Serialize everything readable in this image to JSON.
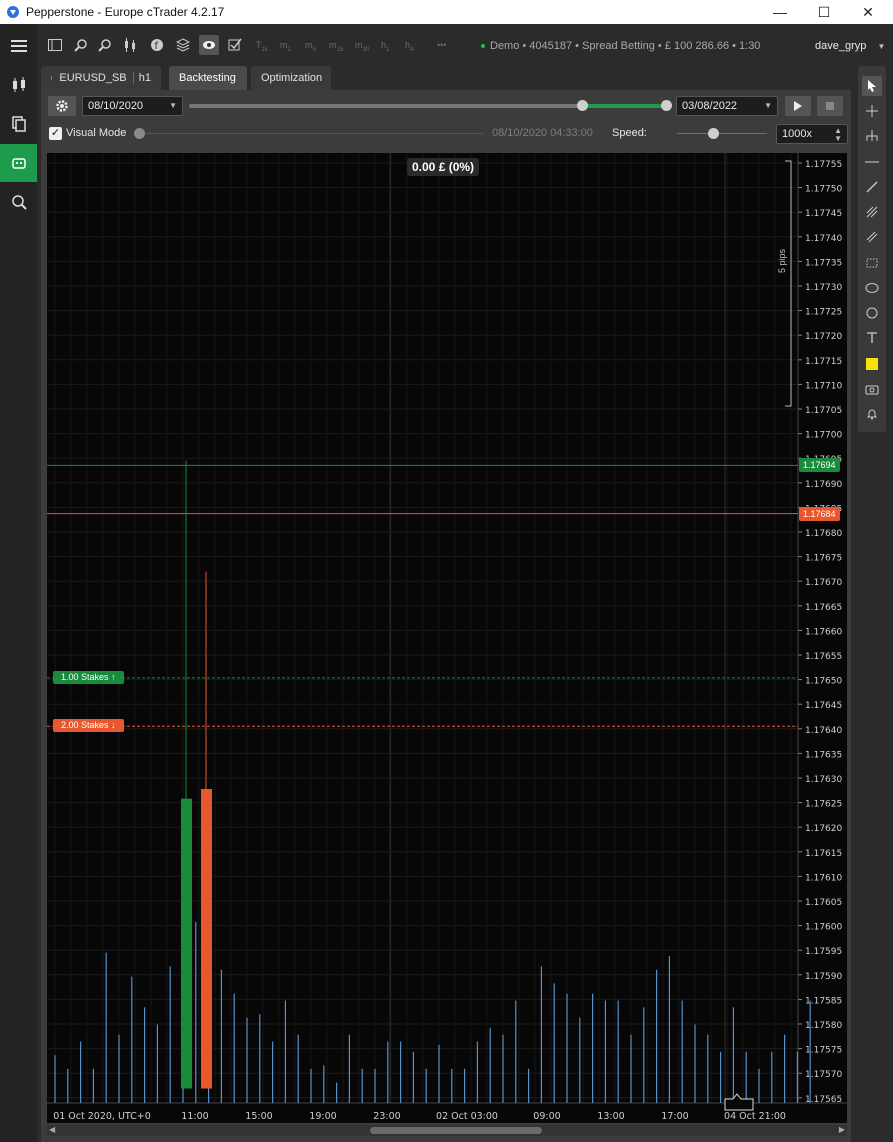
{
  "window": {
    "title": "Pepperstone - Europe cTrader 4.2.17"
  },
  "toolbar": {
    "timeframes": [
      {
        "main": "T",
        "sub": "1k"
      },
      {
        "main": "m",
        "sub": "1"
      },
      {
        "main": "m",
        "sub": "5"
      },
      {
        "main": "m",
        "sub": "15"
      },
      {
        "main": "m",
        "sub": "30"
      },
      {
        "main": "h",
        "sub": "1"
      },
      {
        "main": "h",
        "sub": "4"
      }
    ],
    "more": "•••",
    "account": "Demo • 4045187 • Spread Betting • £ 100 286.66 • 1:30",
    "username": "dave_gryp"
  },
  "tabs": {
    "symbol": "EURUSD_SB",
    "timeframe": "h1",
    "backtesting": "Backtesting",
    "optimization": "Optimization"
  },
  "backtest": {
    "start_date": "08/10/2020",
    "end_date": "03/08/2022",
    "visual_mode_label": "Visual Mode",
    "visual_mode_checked": "✓",
    "current_time": "08/10/2020 04:33:00",
    "speed_label": "Speed:",
    "speed_value": "1000x"
  },
  "chart": {
    "pnl": "0.00 £ (0%)",
    "ask_tag": "1.17694",
    "bid_tag": "1.17684",
    "buy_stake": "1.00 Stakes ↑",
    "sell_stake": "2.00 Stakes ↓",
    "measure": "5 pips",
    "y_labels": [
      "1.17755",
      "1.17750",
      "1.17745",
      "1.17740",
      "1.17735",
      "1.17730",
      "1.17725",
      "1.17720",
      "1.17715",
      "1.17710",
      "1.17705",
      "1.17700",
      "1.17695",
      "1.17690",
      "1.17685",
      "1.17680",
      "1.17675",
      "1.17670",
      "1.17665",
      "1.17660",
      "1.17655",
      "1.17650",
      "1.17645",
      "1.17640",
      "1.17635",
      "1.17630",
      "1.17625",
      "1.17620",
      "1.17615",
      "1.17610",
      "1.17605",
      "1.17600",
      "1.17595",
      "1.17590",
      "1.17585",
      "1.17580",
      "1.17575",
      "1.17570",
      "1.17565"
    ],
    "x_labels": [
      "01 Oct 2020, UTC+0",
      "11:00",
      "15:00",
      "19:00",
      "23:00",
      "02 Oct 03:00",
      "09:00",
      "13:00",
      "17:00",
      "04 Oct 21:00"
    ]
  },
  "chart_data": {
    "type": "bar",
    "ylim": [
      1.17562,
      1.17757
    ],
    "ask": 1.17694,
    "bid": 1.17684,
    "buy_stake_price": 1.1765,
    "sell_stake_price": 1.1764,
    "candles": [
      {
        "x": 0.08,
        "open": 1.17565,
        "close": 1.17625,
        "high": 1.17695,
        "low": 1.17565,
        "dir": "up"
      },
      {
        "x": 0.1,
        "open": 1.17565,
        "close": 1.17627,
        "high": 1.17672,
        "low": 1.17565,
        "dir": "down"
      }
    ],
    "volumes": [
      14,
      10,
      18,
      10,
      44,
      20,
      37,
      28,
      23,
      40,
      30,
      53,
      49,
      39,
      32,
      25,
      26,
      18,
      30,
      20,
      10,
      11,
      6,
      20,
      10,
      10,
      18,
      18,
      15,
      10,
      17,
      10,
      10,
      18,
      22,
      20,
      30,
      10,
      40,
      35,
      32,
      25,
      32,
      30,
      30,
      20,
      28,
      39,
      43,
      30,
      23,
      20,
      15,
      28,
      15,
      10,
      15,
      20,
      15,
      30
    ]
  }
}
